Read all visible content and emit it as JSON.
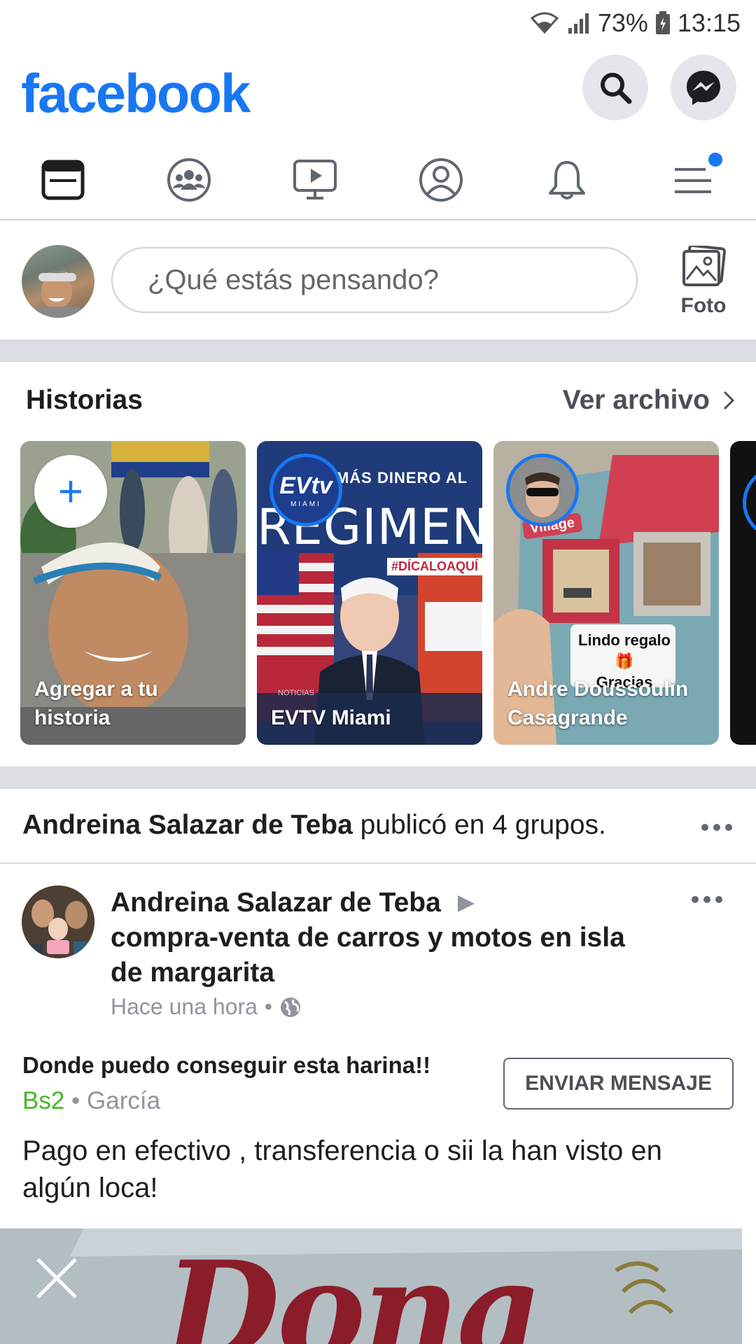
{
  "status_bar": {
    "battery": "73%",
    "time": "13:15"
  },
  "header": {
    "logo": "facebook"
  },
  "nav_tabs": [
    "news-feed",
    "groups",
    "watch",
    "profile",
    "notifications",
    "menu"
  ],
  "composer": {
    "placeholder": "¿Qué estás pensando?",
    "photo_label": "Foto"
  },
  "stories": {
    "title": "Historias",
    "archive_label": "Ver archivo",
    "items": [
      {
        "label": "Agregar a tu historia"
      },
      {
        "label": "EVTV Miami",
        "headline_top": "QUITA MÁS DINERO AL",
        "headline_main": "REGIMEN",
        "hashtag": "#DÍCALOAQUÍ",
        "logo": "EVtv",
        "logo_sub": "MIAMI",
        "tag": "NOTICIAS"
      },
      {
        "label": "Andre Doussoulin Casagrande",
        "sticker_1": "Lindo regalo 🎁",
        "sticker_2": "Gracias",
        "sign": "Village"
      }
    ]
  },
  "post": {
    "shared_author": "Andreina Salazar de Teba",
    "shared_suffix": " publicó en 4 grupos.",
    "author": "Andreina Salazar de Teba",
    "group": "compra-venta de carros y motos en isla de margarita",
    "time": "Hace una hora",
    "listing_title": "Donde puedo conseguir esta harina!!",
    "price": "Bs2",
    "location": "García",
    "send_button": "ENVIAR MENSAJE",
    "body": "Pago en efectivo , transferencia o sii la han visto en algún loca!",
    "image_text": "Dona"
  },
  "colors": {
    "brand": "#1877f2",
    "price": "#42b72a",
    "divider": "#dadde1"
  }
}
